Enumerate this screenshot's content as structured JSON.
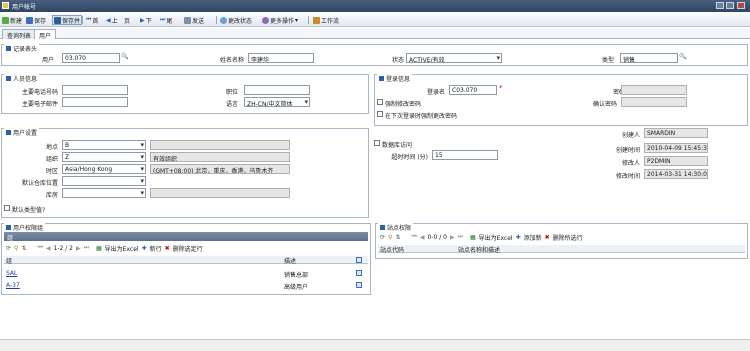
{
  "window": {
    "title": "用户帐号"
  },
  "toolbar": {
    "new": "新建",
    "save": "保存",
    "save_new": "保存并新建",
    "first": "首",
    "prev": "上",
    "page": "页",
    "next": "下",
    "last": "尾",
    "send": "发送",
    "change_status": "更改状态",
    "more_actions": "更多操作",
    "workflow": "工作流"
  },
  "tabs": [
    "查询列表",
    "用户"
  ],
  "record": {
    "header": "记录表头",
    "user_label": "用户",
    "user_value": "03.070",
    "name_label": "姓名名称",
    "name_value": "李建华",
    "status_label": "状态",
    "status_value": "ACTIVE/有效",
    "type_label": "类型",
    "type_value": "销售"
  },
  "person": {
    "header": "人员信息",
    "phone_label": "主要电话号码",
    "phone_value": "",
    "email_label": "主要电子邮件",
    "email_value": "",
    "title_label": "职位",
    "title_value": "",
    "language_label": "语言",
    "language_value": "ZH-CN/中文简体"
  },
  "login": {
    "header": "登录信息",
    "loginid_label": "登录名",
    "loginid_value": "C03.070",
    "password_label": "密码",
    "password_value": "",
    "confirm_label": "确认密码",
    "confirm_value": "",
    "force_change_label": "强制修改密码",
    "expire_label": "在下次登录时强制更改密码"
  },
  "settings": {
    "header": "用户设置",
    "site_label": "地点",
    "site_value": "B",
    "site_desc": "",
    "org_label": "组织",
    "org_value": "Z",
    "org_desc": "有效组织",
    "timezone_label": "时区",
    "timezone_value": "Asia/Hong Kong",
    "timezone_desc": "(GMT+08:00) 北京，重庆，香港，乌鲁木齐",
    "store_label": "默认仓库位置",
    "store_value": "",
    "storeroom_label": "库房",
    "storeroom_value": "",
    "store_desc": "",
    "default_check_label": "默认类型值?",
    "dbaccess_label": "数据库访问",
    "timeout_label": "超时时间 (分)",
    "timeout_value": "15"
  },
  "audit": {
    "created_by_label": "创建人",
    "created_by": "SMARDIN",
    "created_on_label": "创建时间",
    "created_on": "2010-04-09 15:45:35",
    "changed_by_label": "修改人",
    "changed_by": "P2DMIN",
    "changed_on_label": "修改时间",
    "changed_on": "2014-03-31 14:30:04"
  },
  "groups": {
    "header": "用户权限组",
    "grid_title": "组",
    "paging": "1-2 / 2",
    "download": "导出为Excel",
    "new_row": "新行",
    "delete_row": "删除选定行",
    "col1": "组",
    "col2": "描述",
    "rows": [
      {
        "group": "SAL",
        "desc": "销售总部"
      },
      {
        "group": "A-37",
        "desc": "高级用户"
      }
    ]
  },
  "sitegroups": {
    "header": "站点权限",
    "paging": "0-0 / 0",
    "download": "导出为Excel",
    "new_row": "添加新",
    "delete_row": "删除所选行",
    "col1": "站点代码",
    "col2": "站点名称和描述"
  }
}
